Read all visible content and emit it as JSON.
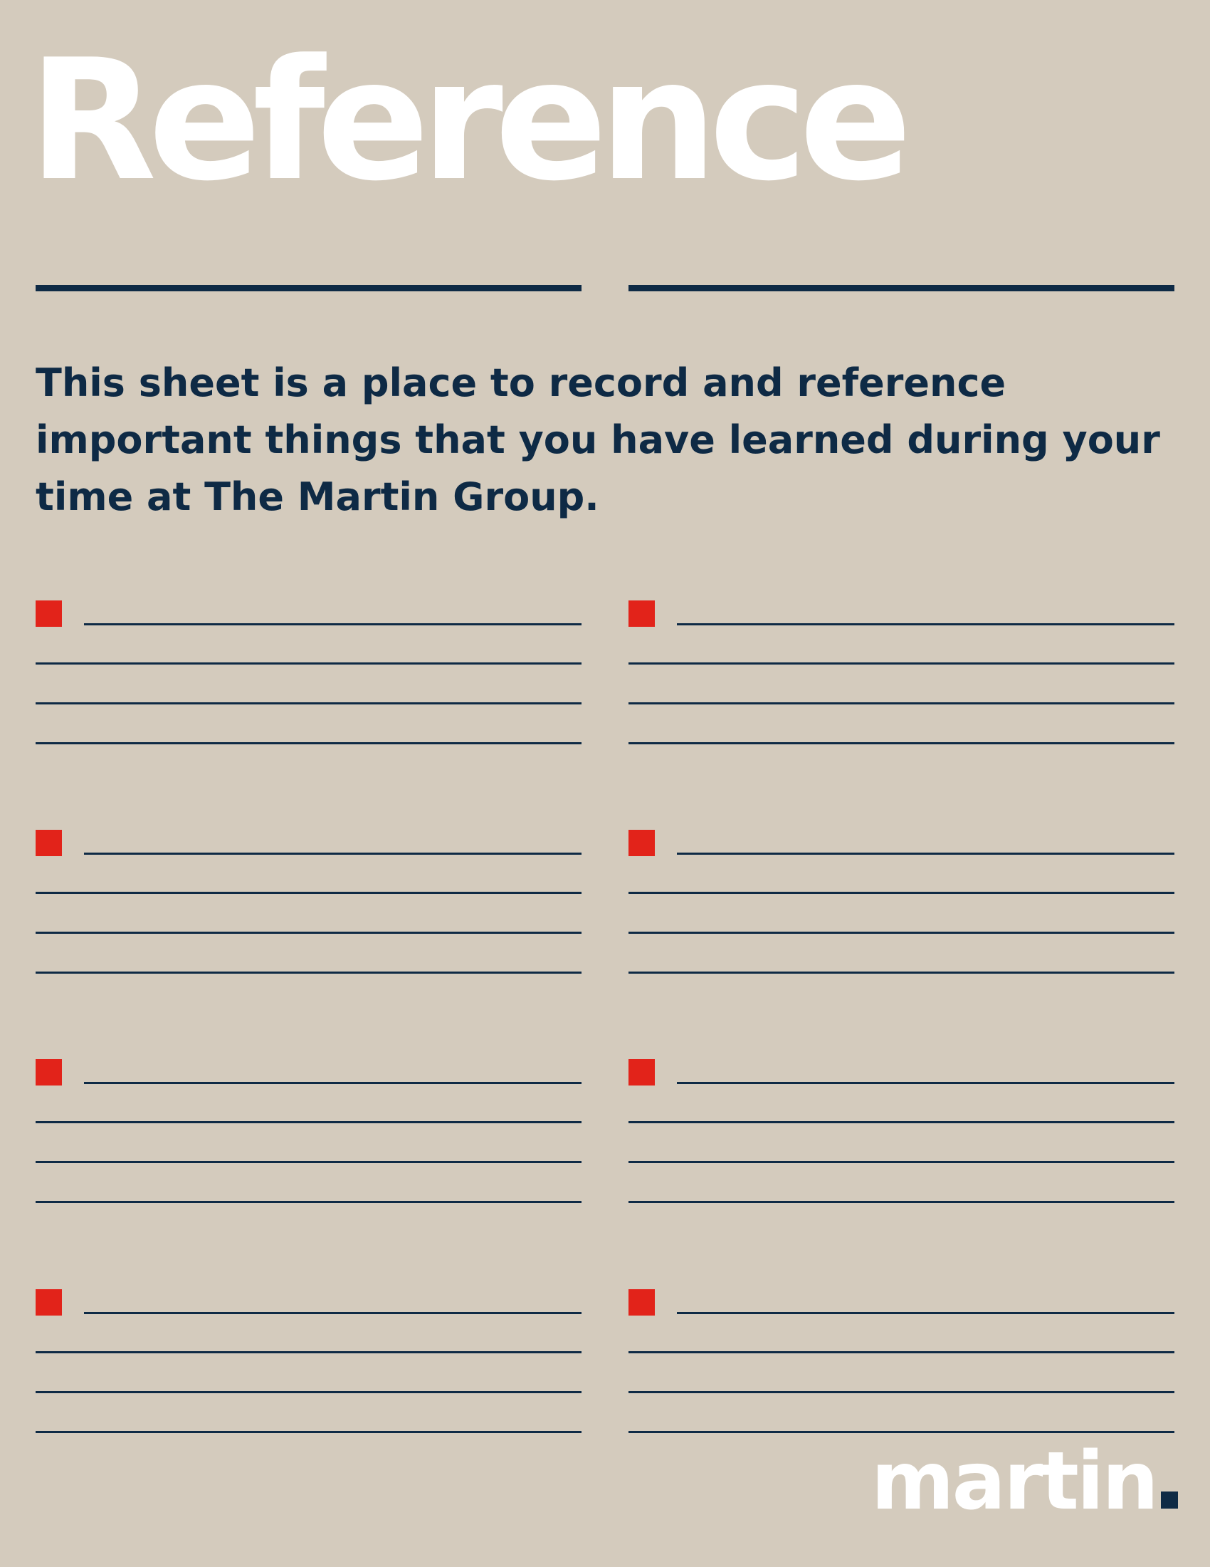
{
  "header": {
    "title": "Reference"
  },
  "intro": {
    "text": "This sheet is a place to record and reference important things that you have learned during your time at The Martin Group."
  },
  "logo": {
    "wordmark": "martin"
  },
  "colors": {
    "background": "#d4cbbd",
    "title_text": "#ffffff",
    "navy": "#0e2a45",
    "bullet_red": "#e2231a"
  },
  "note_blocks": {
    "count": 8,
    "lines_per_block": 4
  }
}
